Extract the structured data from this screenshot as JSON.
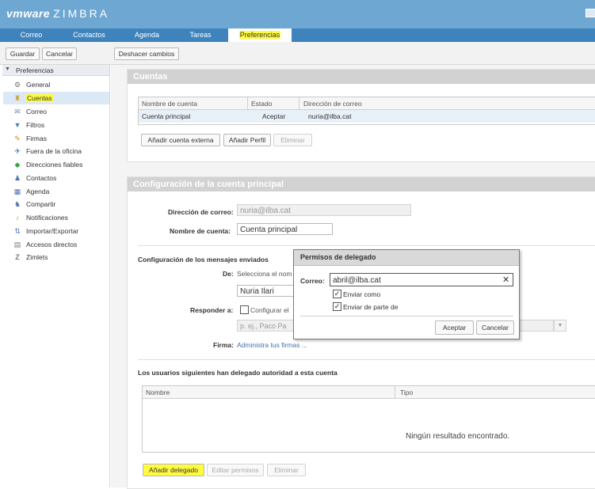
{
  "header": {
    "logo_brand": "vmware",
    "logo_product": "ZIMBRA"
  },
  "tabs": [
    {
      "label": "Correo"
    },
    {
      "label": "Contactos"
    },
    {
      "label": "Agenda"
    },
    {
      "label": "Tareas"
    },
    {
      "label": "Preferencias",
      "active": true,
      "highlighted": true
    }
  ],
  "toolbar": {
    "save": "Guardar",
    "cancel": "Cancelar",
    "undo": "Deshacer cambios"
  },
  "sidebar": {
    "title": "Preferencias",
    "items": [
      {
        "label": "General",
        "icon": "gear-icon"
      },
      {
        "label": "Cuentas",
        "icon": "accounts-icon",
        "selected": true,
        "highlighted": true
      },
      {
        "label": "Correo",
        "icon": "mail-icon"
      },
      {
        "label": "Filtros",
        "icon": "filter-icon"
      },
      {
        "label": "Firmas",
        "icon": "signature-icon"
      },
      {
        "label": "Fuera de la oficina",
        "icon": "out-of-office-icon"
      },
      {
        "label": "Direcciones fiables",
        "icon": "shield-icon"
      },
      {
        "label": "Contactos",
        "icon": "contacts-icon"
      },
      {
        "label": "Agenda",
        "icon": "calendar-icon"
      },
      {
        "label": "Compartir",
        "icon": "share-icon"
      },
      {
        "label": "Notificaciones",
        "icon": "bell-icon"
      },
      {
        "label": "Importar/Exportar",
        "icon": "import-export-icon"
      },
      {
        "label": "Accesos directos",
        "icon": "shortcuts-icon"
      },
      {
        "label": "Zimlets",
        "icon": "zimlets-icon"
      }
    ]
  },
  "accounts": {
    "title": "Cuentas",
    "columns": [
      "Nombre de cuenta",
      "Estado",
      "Dirección de correo"
    ],
    "rows": [
      {
        "name": "Cuenta principal",
        "status": "Aceptar",
        "email": "nuria@ilba.cat"
      }
    ],
    "buttons": {
      "add_external": "Añadir cuenta externa",
      "add_persona": "Añadir Perfil",
      "delete": "Eliminar"
    }
  },
  "config": {
    "title": "Configuración de la cuenta principal",
    "email_label": "Dirección de correo:",
    "email_value": "nuria@ilba.cat",
    "account_name_label": "Nombre de cuenta:",
    "account_name_value": "Cuenta principal",
    "sent_section": "Configuración de los mensajes enviados",
    "from_label": "De:",
    "from_hint": "Selecciona el nom",
    "from_name": "Nuria Ilari",
    "reply_label": "Responder a:",
    "reply_check_label": "Configurar el",
    "reply_placeholder": "p. ej., Paco Pa",
    "signature_label": "Firma:",
    "signature_link": "Administra tus firmas ...",
    "delegates_section": "Los usuarios siguientes han delegado autoridad a esta cuenta",
    "delegates_columns": [
      "Nombre",
      "Tipo"
    ],
    "delegates_empty": "Ningún resultado encontrado.",
    "delegates_buttons": {
      "add": "Añadir delegado",
      "edit": "Editar permisos",
      "delete": "Eliminar"
    }
  },
  "dialog": {
    "title": "Permisos de delegado",
    "email_label": "Correo:",
    "email_value": "abril@ilba.cat",
    "send_as": "Enviar como",
    "send_on_behalf": "Enviar de parte de",
    "ok": "Aceptar",
    "cancel": "Cancelar"
  },
  "colors": {
    "header": "#6ea7d2",
    "tabbar": "#3f83bd",
    "highlight": "#fffb3e",
    "panel_header": "#d2d2d2",
    "link": "#3f6fb0"
  }
}
